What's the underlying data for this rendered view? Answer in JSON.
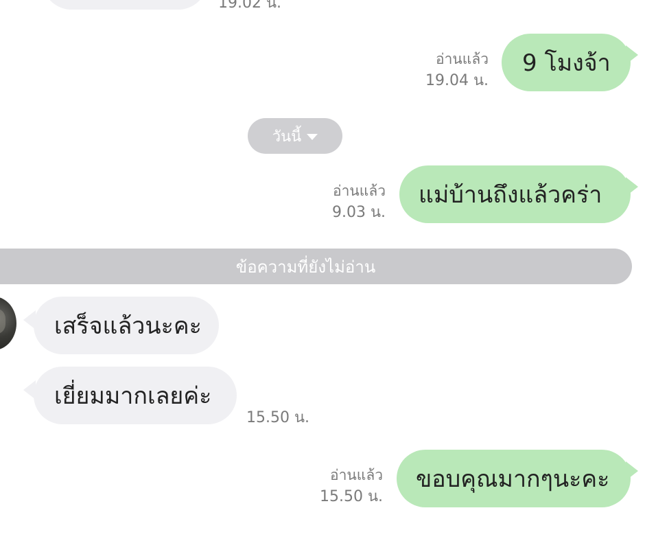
{
  "chat": {
    "partial_top_time": "19.02 น.",
    "msg1": {
      "text": "9 โมงจ้า",
      "read": "อ่านแล้ว",
      "time": "19.04 น."
    },
    "date_pill": {
      "label": "วันนี้"
    },
    "msg2": {
      "text": "แม่บ้านถึงแล้วคร่า",
      "read": "อ่านแล้ว",
      "time": "9.03 น."
    },
    "unread_divider": "ข้อความที่ยังไม่อ่าน",
    "in1": {
      "text": "เสร็จแล้วนะคะ"
    },
    "in2": {
      "text": "เยี่ยมมากเลยค่ะ",
      "time": "15.50 น."
    },
    "msg3": {
      "text": "ขอบคุณมากๆนะคะ",
      "read": "อ่านแล้ว",
      "time": "15.50 น."
    }
  },
  "colors": {
    "outgoing_bubble": "#b9e8b8",
    "incoming_bubble": "#f0f0f3",
    "divider": "#c9c9cc",
    "meta_text": "#7a7a7a"
  },
  "icons": {
    "date_dropdown": "chevron-down-icon",
    "avatar": "avatar"
  }
}
